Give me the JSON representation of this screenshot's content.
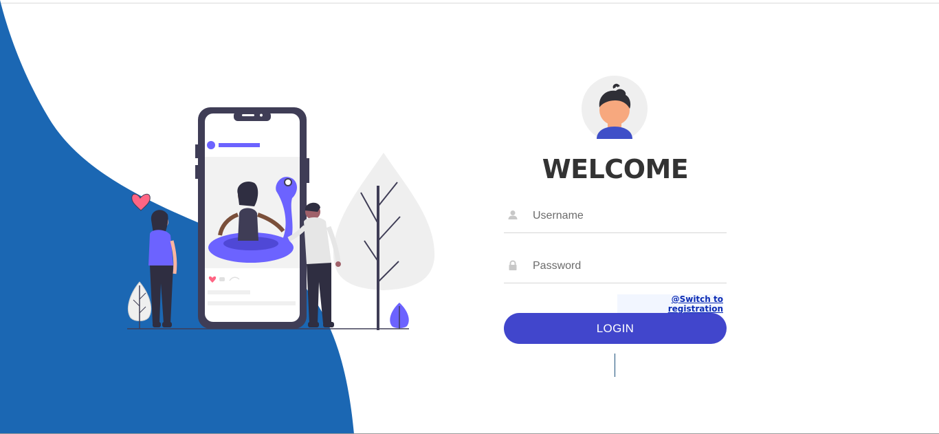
{
  "colors": {
    "wave_blue": "#1b67b3",
    "button_purple": "#4146cc",
    "illustration_purple": "#6c63ff",
    "phone_dark": "#3f3d56",
    "link_blue": "#0b2bb4"
  },
  "avatar": {
    "icon": "user-avatar-icon"
  },
  "welcome": {
    "title": "WELCOME"
  },
  "form": {
    "username": {
      "placeholder": "Username",
      "value": "",
      "icon": "user-icon"
    },
    "password": {
      "placeholder": "Password",
      "value": "",
      "icon": "lock-icon"
    },
    "switch_link": "@Switch to registration",
    "login_label": "LOGIN"
  }
}
